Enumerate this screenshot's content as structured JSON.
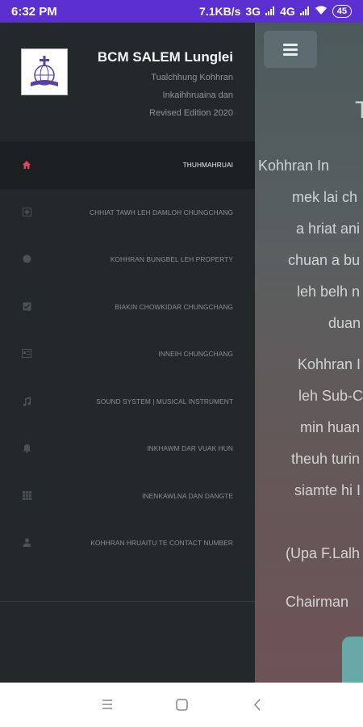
{
  "status_bar": {
    "time": "6:32 PM",
    "network_speed": "7.1KB/s",
    "network_type": "3G",
    "network_type_2": "4G",
    "battery": "45"
  },
  "background_page": {
    "title_fragment": "T",
    "paragraph_1": [
      "Kohhran In",
      "mek lai ch",
      "a hriat ani",
      "chuan a bu",
      "leh belh n",
      "duan"
    ],
    "paragraph_2": [
      "Kohhran I",
      "leh Sub-C",
      "min huan",
      "theuh turin",
      "siamte hi I"
    ],
    "signed": "(Upa F.Lalh",
    "role": "Chairman"
  },
  "drawer": {
    "app_name": "BCM SALEM Lunglei",
    "subtitle_lines": [
      "Tualchhung Kohhran",
      "Inkaihhruaina dan",
      "Revised Edition 2020"
    ],
    "items": [
      {
        "label": "THUHMAHRUAI",
        "icon": "home-icon"
      },
      {
        "label": "CHHIAT TAWH LEH DAMLOH CHUNGCHANG",
        "icon": "medical-icon"
      },
      {
        "label": "KOHHRAN BUNGBEL LEH PROPERTY",
        "icon": "circle-icon"
      },
      {
        "label": "BIAKIN CHOWKIDAR CHUNGCHANG",
        "icon": "check-square-icon"
      },
      {
        "label": "INNEIH CHUNGCHANG",
        "icon": "card-icon"
      },
      {
        "label": "SOUND SYSTEM | MUSICAL INSTRUMENT",
        "icon": "music-icon"
      },
      {
        "label": "INKHAWM DAR VUAK HUN",
        "icon": "bell-icon"
      },
      {
        "label": "INENKAWLNA DAN DANGTE",
        "icon": "grid-icon"
      },
      {
        "label": "KOHHRAN HRUAITU TE CONTACT NUMBER",
        "icon": "person-icon"
      }
    ]
  },
  "colors": {
    "status_bar": "#5b2fd0",
    "drawer_bg": "#23282b",
    "active_icon": "#e04558"
  }
}
